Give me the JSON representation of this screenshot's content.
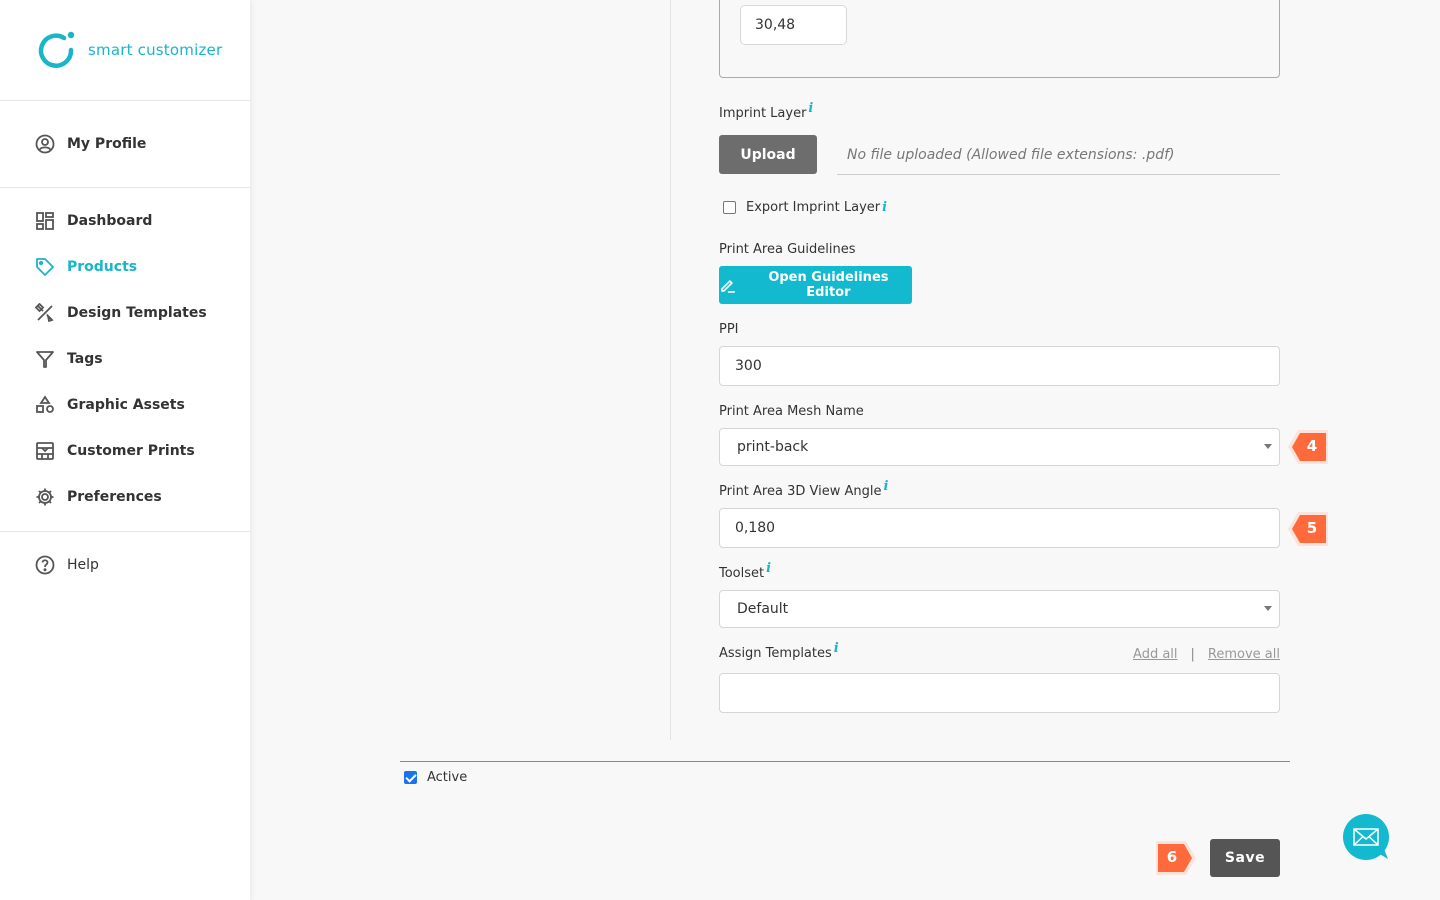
{
  "brand": {
    "name": "smart customizer",
    "accent": "#19b5c9"
  },
  "sidebar": {
    "profile": {
      "label": "My Profile",
      "icon": "user-circle-icon"
    },
    "items": [
      {
        "label": "Dashboard",
        "icon": "dashboard-icon",
        "active": false
      },
      {
        "label": "Products",
        "icon": "tag-icon",
        "active": true
      },
      {
        "label": "Design Templates",
        "icon": "design-tools-icon",
        "active": false
      },
      {
        "label": "Tags",
        "icon": "filter-icon",
        "active": false
      },
      {
        "label": "Graphic Assets",
        "icon": "shapes-icon",
        "active": false
      },
      {
        "label": "Customer Prints",
        "icon": "prints-icon",
        "active": false
      },
      {
        "label": "Preferences",
        "icon": "gear-icon",
        "active": false
      }
    ],
    "help": {
      "label": "Help",
      "icon": "question-circle-icon"
    }
  },
  "form": {
    "top_value": "30,48",
    "imprint_layer": {
      "label": "Imprint Layer",
      "upload_label": "Upload",
      "file_status": "No file uploaded (Allowed file extensions: .pdf)"
    },
    "export_imprint": {
      "label": "Export Imprint Layer",
      "checked": false
    },
    "guidelines": {
      "label": "Print Area Guidelines",
      "button_label": "Open Guidelines Editor"
    },
    "ppi": {
      "label": "PPI",
      "value": "300"
    },
    "mesh_name": {
      "label": "Print Area Mesh Name",
      "value": "print-back"
    },
    "view_angle": {
      "label": "Print Area 3D View Angle",
      "value": "0,180"
    },
    "toolset": {
      "label": "Toolset",
      "value": "Default"
    },
    "assign_templates": {
      "label": "Assign Templates",
      "add_all": "Add all",
      "separator": "|",
      "remove_all": "Remove all",
      "value": ""
    },
    "active": {
      "label": "Active",
      "checked": true
    },
    "save_label": "Save"
  },
  "annotations": [
    {
      "number": "4",
      "color": "#ff6a3d"
    },
    {
      "number": "5",
      "color": "#ff6a3d"
    },
    {
      "number": "6",
      "color": "#ff6a3d"
    }
  ],
  "info_glyph": "i"
}
